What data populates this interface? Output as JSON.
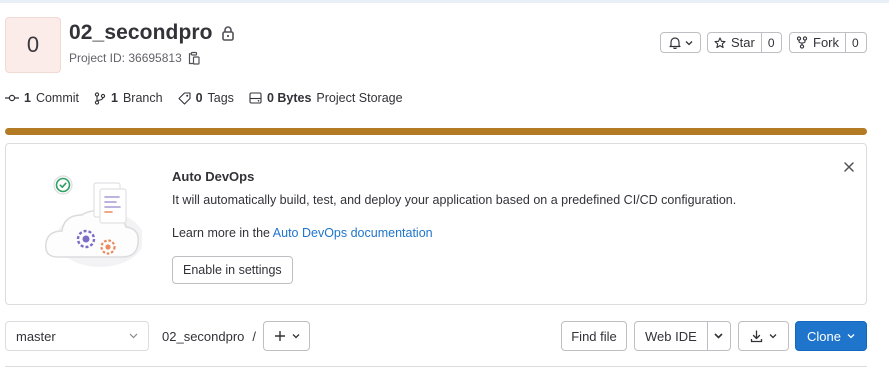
{
  "project": {
    "avatar_letter": "0",
    "title": "02_secondpro",
    "id_text": "Project ID: 36695813"
  },
  "actions": {
    "star_label": "Star",
    "star_count": "0",
    "fork_label": "Fork",
    "fork_count": "0"
  },
  "stats": [
    {
      "value": "1",
      "label": "Commit"
    },
    {
      "value": "1",
      "label": "Branch"
    },
    {
      "value": "0",
      "label": "Tags"
    },
    {
      "value": "0 Bytes",
      "label": "Project Storage"
    }
  ],
  "usage_bar": {
    "fill_percent": 100,
    "color": "#b37c24"
  },
  "auto_devops": {
    "title": "Auto DevOps",
    "description": "It will automatically build, test, and deploy your application based on a predefined CI/CD configuration.",
    "learn_prefix": "Learn more in the",
    "learn_link": "Auto DevOps documentation",
    "enable_button": "Enable in settings"
  },
  "repo_bar": {
    "branch": "master",
    "breadcrumb_project": "02_secondpro",
    "breadcrumb_sep": "/",
    "find_file": "Find file",
    "web_ide": "Web IDE",
    "clone": "Clone"
  },
  "colors": {
    "accent_blue": "#1f75cb",
    "clone_bg": "#1f75cb",
    "storage_bar": "#b37c24"
  }
}
